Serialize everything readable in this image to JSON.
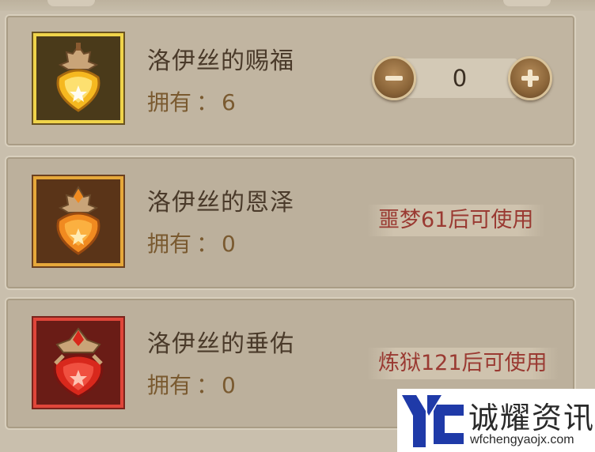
{
  "items": [
    {
      "name": "洛伊丝的赐福",
      "owned_label": "拥有",
      "owned_sep": "：",
      "owned_count": "6",
      "rarity_color": "#f0d44a",
      "gem_color": "#f5b820",
      "stepper": {
        "value": "0",
        "minus_icon": "minus-icon",
        "plus_icon": "plus-icon"
      }
    },
    {
      "name": "洛伊丝的恩泽",
      "owned_label": "拥有",
      "owned_sep": "：",
      "owned_count": "0",
      "rarity_color": "#e6a83a",
      "gem_color": "#f08a20",
      "requirement": "噩梦61后可使用"
    },
    {
      "name": "洛伊丝的垂佑",
      "owned_label": "拥有",
      "owned_sep": "：",
      "owned_count": "0",
      "rarity_color": "#e0463a",
      "gem_color": "#d8281c",
      "requirement": "炼狱121后可使用"
    }
  ],
  "watermark": {
    "title": "诚耀资讯",
    "url": "wfchengyaojx.com",
    "logo_icon": "yc-logo-icon"
  }
}
